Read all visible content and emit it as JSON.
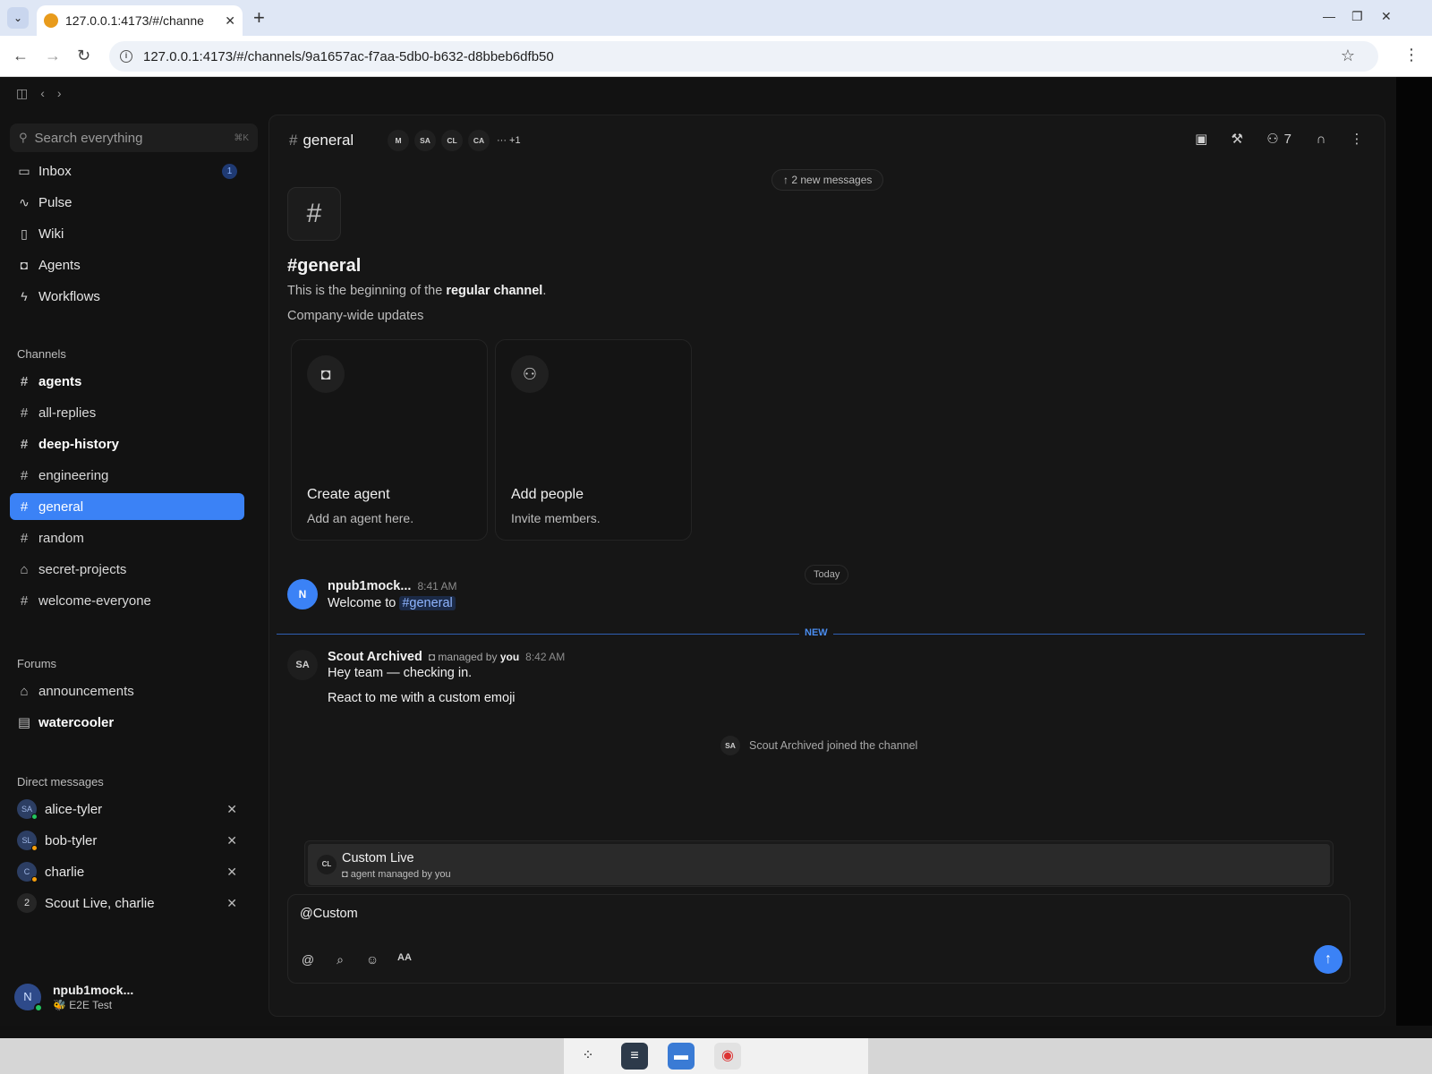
{
  "browser": {
    "tab_title": "127.0.0.1:4173/#/channe",
    "url": "127.0.0.1:4173/#/channels/9a1657ac-f7aa-5db0-b632-d8bbeb6dfb50"
  },
  "sidebar": {
    "search_placeholder": "Search everything",
    "search_shortcut": "⌘K",
    "nav": [
      {
        "label": "Inbox",
        "icon": "inbox-icon",
        "badge": "1"
      },
      {
        "label": "Pulse",
        "icon": "pulse-icon"
      },
      {
        "label": "Wiki",
        "icon": "book-icon"
      },
      {
        "label": "Agents",
        "icon": "bot-icon"
      },
      {
        "label": "Workflows",
        "icon": "bolt-icon"
      }
    ],
    "channels_header": "Channels",
    "channels": [
      {
        "label": "agents",
        "bold": true
      },
      {
        "label": "all-replies"
      },
      {
        "label": "deep-history",
        "bold": true
      },
      {
        "label": "engineering"
      },
      {
        "label": "general",
        "active": true
      },
      {
        "label": "random"
      },
      {
        "label": "secret-projects",
        "private": true
      },
      {
        "label": "welcome-everyone"
      }
    ],
    "forums_header": "Forums",
    "forums": [
      {
        "label": "announcements",
        "icon": "lock-icon"
      },
      {
        "label": "watercooler",
        "icon": "doc-icon",
        "bold": true
      }
    ],
    "dms_header": "Direct messages",
    "dms": [
      {
        "label": "alice-tyler",
        "avatar": "SA",
        "status": "#22c55e"
      },
      {
        "label": "bob-tyler",
        "avatar": "SL",
        "status": "#f59e0b"
      },
      {
        "label": "charlie",
        "avatar": "C",
        "status": "#f59e0b"
      },
      {
        "label": "Scout Live, charlie",
        "avatar": "2"
      }
    ],
    "user": {
      "avatar": "N",
      "name": "npub1mock...",
      "status": "🐝 E2E Test"
    }
  },
  "channel": {
    "name": "general",
    "member_avatars": [
      "M",
      "SA",
      "CL",
      "CA"
    ],
    "more_members": "··· +1",
    "member_count": "7",
    "new_messages_pill": "2 new messages",
    "hero_title": "#general",
    "hero_desc_prefix": "This is the beginning of the ",
    "hero_desc_bold": "regular channel",
    "hero_desc_suffix": ".",
    "topic": "Company-wide updates",
    "cards": [
      {
        "title": "Create agent",
        "subtitle": "Add an agent here.",
        "icon": "bot-icon"
      },
      {
        "title": "Add people",
        "subtitle": "Invite members.",
        "icon": "user-plus-icon"
      }
    ],
    "day_label": "Today",
    "new_label": "NEW",
    "messages": [
      {
        "avatar": "N",
        "author": "npub1mock...",
        "time": "8:41 AM",
        "text_prefix": "Welcome to ",
        "chip": "#general"
      },
      {
        "avatar": "SA",
        "author": "Scout Archived",
        "managed_prefix": "managed by",
        "managed_by": "you",
        "time": "8:42 AM",
        "lines": [
          "Hey team — checking in.",
          "React to me with a custom emoji"
        ]
      }
    ],
    "join_avatar": "SA",
    "join_text": "Scout Archived joined the channel"
  },
  "mention": {
    "avatar": "CL",
    "name": "Custom Live",
    "subtitle": "agent  managed by you"
  },
  "composer": {
    "value": "@Custom",
    "format_label": "AA"
  },
  "colors": {
    "accent": "#3b82f6",
    "bg": "#121212"
  }
}
